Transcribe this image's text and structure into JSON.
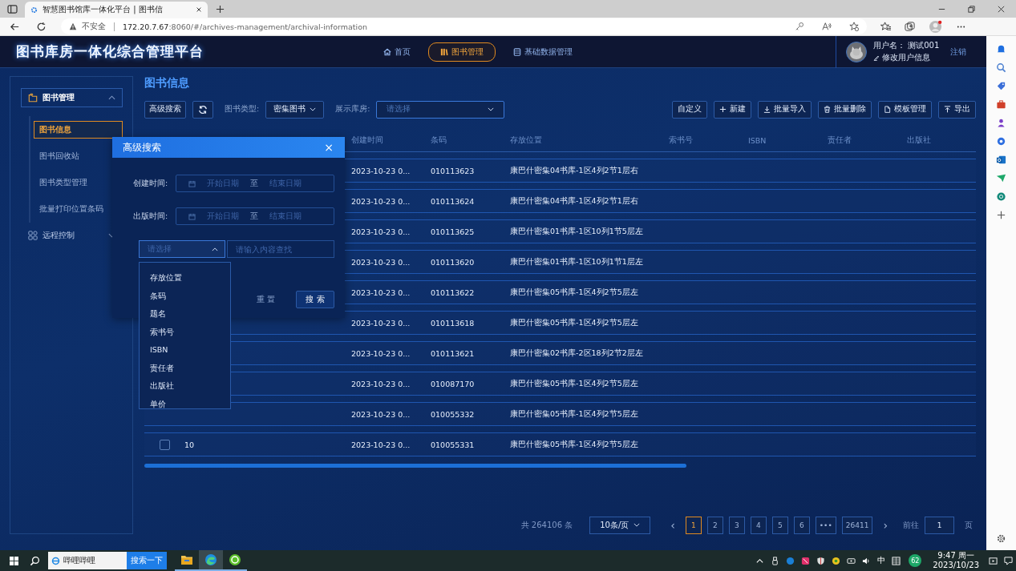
{
  "browser": {
    "tab_title": "智慧图书馆库一体化平台 | 图书信",
    "security": "不安全",
    "url_host": "172.20.7.67",
    "url_rest": ":8060/#/archives-management/archival-information"
  },
  "header": {
    "title": "图书库房一体化综合管理平台",
    "nav": [
      {
        "label": "首页",
        "selected": false
      },
      {
        "label": "图书管理",
        "selected": true
      },
      {
        "label": "基础数据管理",
        "selected": false
      }
    ],
    "user_label": "用户名：",
    "user_name": "测试001",
    "edit_profile": "修改用户信息",
    "logout": "注销"
  },
  "sidebar": {
    "groups": [
      {
        "label": "图书管理",
        "expanded": true,
        "children": [
          {
            "label": "图书信息",
            "selected": true
          },
          {
            "label": "图书回收站",
            "selected": false
          },
          {
            "label": "图书类型管理",
            "selected": false
          },
          {
            "label": "批量打印位置条码",
            "selected": false
          }
        ]
      },
      {
        "label": "远程控制",
        "expanded": false
      }
    ]
  },
  "page_title": "图书信息",
  "toolbar": {
    "advanced_search": "高级搜索",
    "type_label": "图书类型:",
    "type_value": "密集图书",
    "store_label": "展示库房:",
    "store_placeholder": "请选择",
    "actions": [
      "自定义",
      "新建",
      "批量导入",
      "批量删除",
      "模板管理",
      "导出"
    ]
  },
  "table": {
    "columns": [
      "创建时间",
      "条码",
      "存放位置",
      "索书号",
      "ISBN",
      "责任者",
      "出版社"
    ],
    "rows": [
      {
        "created": "2023-10-23 0...",
        "barcode": "010113623",
        "location": "康巴什密集04书库-1区4列2节1层右"
      },
      {
        "created": "2023-10-23 0...",
        "barcode": "010113624",
        "location": "康巴什密集04书库-1区4列2节1层右"
      },
      {
        "created": "2023-10-23 0...",
        "barcode": "010113625",
        "location": "康巴什密集01书库-1区10列1节5层左"
      },
      {
        "created": "2023-10-23 0...",
        "barcode": "010113620",
        "location": "康巴什密集01书库-1区10列1节1层左"
      },
      {
        "created": "2023-10-23 0...",
        "barcode": "010113622",
        "location": "康巴什密集05书库-1区4列2节5层左"
      },
      {
        "created": "2023-10-23 0...",
        "barcode": "010113618",
        "location": "康巴什密集05书库-1区4列2节5层左"
      },
      {
        "created": "2023-10-23 0...",
        "barcode": "010113621",
        "location": "康巴什密集02书库-2区18列2节2层左"
      },
      {
        "created": "2023-10-23 0...",
        "barcode": "010087170",
        "location": "康巴什密集05书库-1区4列2节5层左"
      },
      {
        "created": "2023-10-23 0...",
        "barcode": "010055332",
        "location": "康巴什密集05书库-1区4列2节5层左"
      },
      {
        "checked": false,
        "no": "10",
        "created": "2023-10-23 0...",
        "barcode": "010055331",
        "location": "康巴什密集05书库-1区4列2节5层左"
      }
    ]
  },
  "pagination": {
    "total": "共 264106 条",
    "page_size": "10条/页",
    "prev": "‹",
    "next": "›",
    "pages": [
      {
        "label": "1",
        "selected": true
      },
      {
        "label": "2",
        "selected": false
      },
      {
        "label": "3",
        "selected": false
      },
      {
        "label": "4",
        "selected": false
      },
      {
        "label": "5",
        "selected": false
      },
      {
        "label": "6",
        "selected": false
      },
      {
        "label": "•••",
        "selected": false
      },
      {
        "label": "26411",
        "selected": false
      }
    ],
    "goto_label": "前往",
    "goto_value": "1",
    "page_unit": "页"
  },
  "dialog": {
    "title": "高级搜索",
    "close": "×",
    "date_fields": [
      {
        "label": "创建时间:",
        "start": "开始日期",
        "sep": "至",
        "end": "结束日期"
      },
      {
        "label": "出版时间:",
        "start": "开始日期",
        "sep": "至",
        "end": "结束日期"
      }
    ],
    "select_placeholder": "请选择",
    "select_expanded": true,
    "search_placeholder": "请输入内容查找",
    "reset": "重 置",
    "submit": "搜 索",
    "options": [
      "存放位置",
      "条码",
      "题名",
      "索书号",
      "ISBN",
      "责任者",
      "出版社",
      "单价"
    ]
  },
  "taskbar": {
    "search_text": "哔哩哔哩",
    "search_button": "搜索一下",
    "apps": [
      {
        "kind": "explorer",
        "selected": false
      },
      {
        "kind": "edge",
        "selected": true
      },
      {
        "kind": "green",
        "selected": false
      }
    ],
    "ime": "中",
    "badge": "62",
    "time": "9:47 周一",
    "date": "2023/10/23"
  }
}
